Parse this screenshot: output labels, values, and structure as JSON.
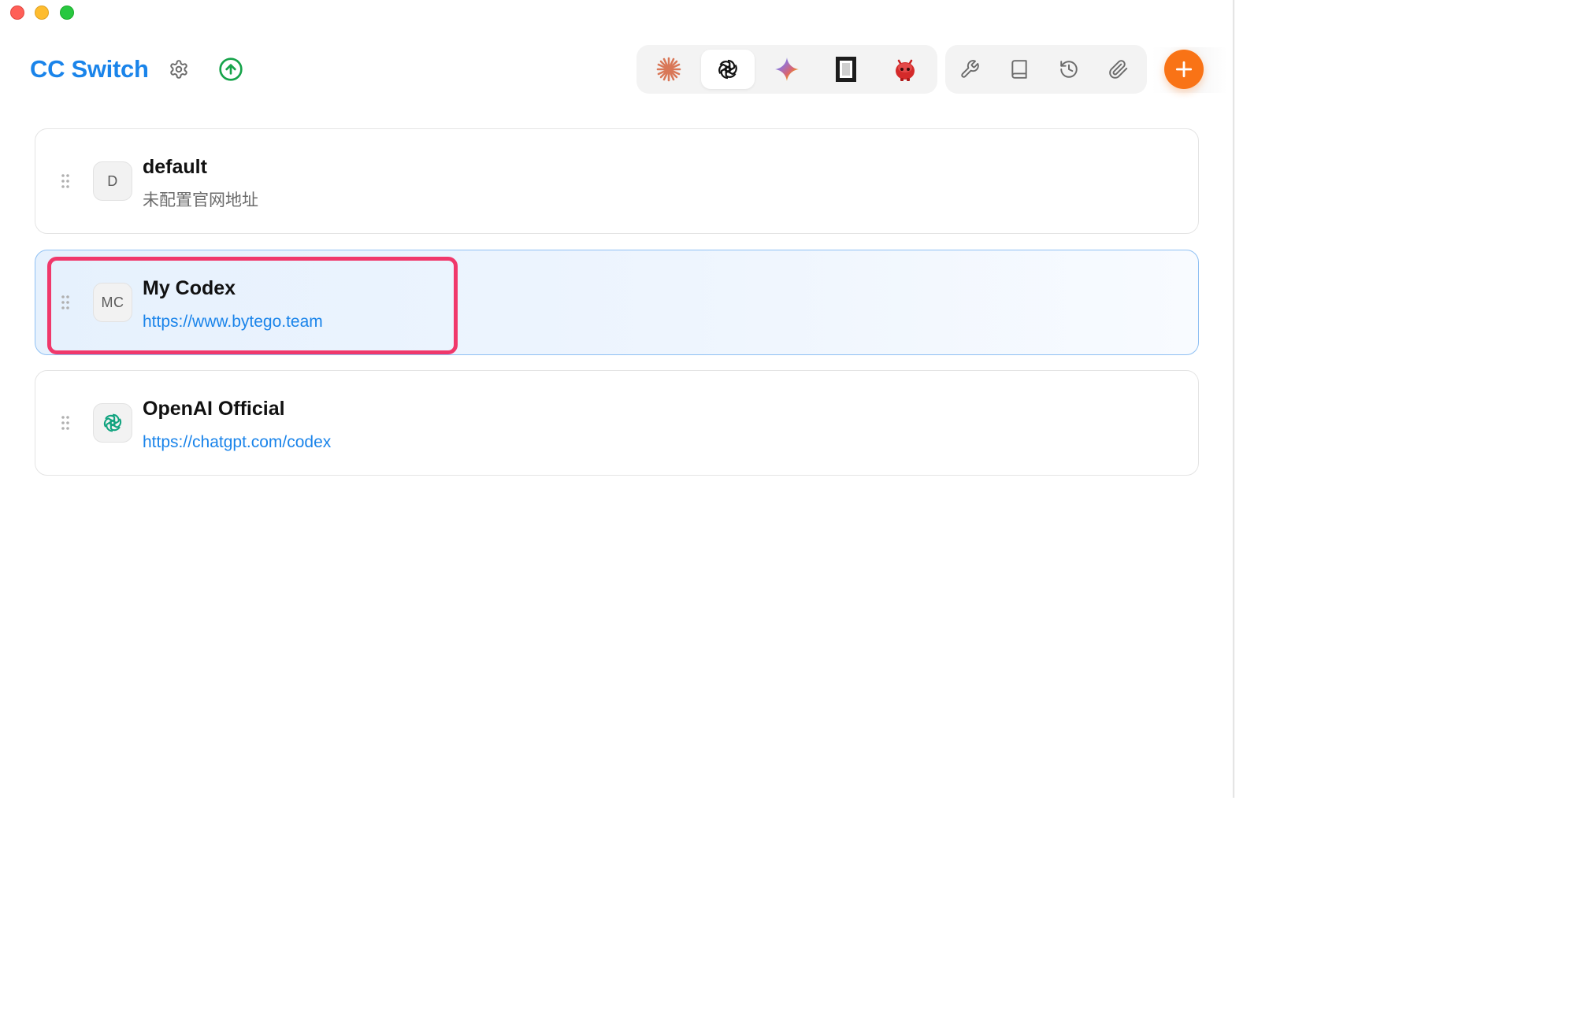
{
  "window": {
    "traffic_lights": [
      "close",
      "minimize",
      "maximize"
    ]
  },
  "header": {
    "app_title": "CC Switch",
    "settings_icon": "gear-icon",
    "update_icon": "arrow-up-circle-icon",
    "app_tabs": [
      {
        "name": "claude",
        "icon": "claude-sparkle-icon",
        "active": false
      },
      {
        "name": "codex",
        "icon": "openai-knot-icon",
        "active": true
      },
      {
        "name": "gemini",
        "icon": "gemini-star-icon",
        "active": false
      },
      {
        "name": "opencode",
        "icon": "square-bracket-icon",
        "active": false
      },
      {
        "name": "red-robot",
        "icon": "red-robot-icon",
        "active": false
      }
    ],
    "tools": [
      {
        "name": "wrench",
        "icon": "wrench-icon"
      },
      {
        "name": "book",
        "icon": "book-icon"
      },
      {
        "name": "history",
        "icon": "history-icon"
      },
      {
        "name": "paperclip",
        "icon": "paperclip-icon"
      }
    ],
    "add_icon": "plus-icon"
  },
  "providers": [
    {
      "avatar": "D",
      "name": "default",
      "subtitle": "未配置官网地址",
      "subtitle_type": "muted",
      "active": false
    },
    {
      "avatar": "MC",
      "name": "My Codex",
      "subtitle": "https://www.bytego.team",
      "subtitle_type": "link",
      "active": true
    },
    {
      "avatar": "",
      "avatar_icon": "openai-knot-icon",
      "name": "OpenAI Official",
      "subtitle": "https://chatgpt.com/codex",
      "subtitle_type": "link",
      "active": false
    }
  ],
  "colors": {
    "brand_blue": "#1a84ea",
    "add_orange": "#f97316",
    "update_green": "#16a34a",
    "highlight_pink": "#f0386b",
    "openai_green": "#10a37f"
  }
}
